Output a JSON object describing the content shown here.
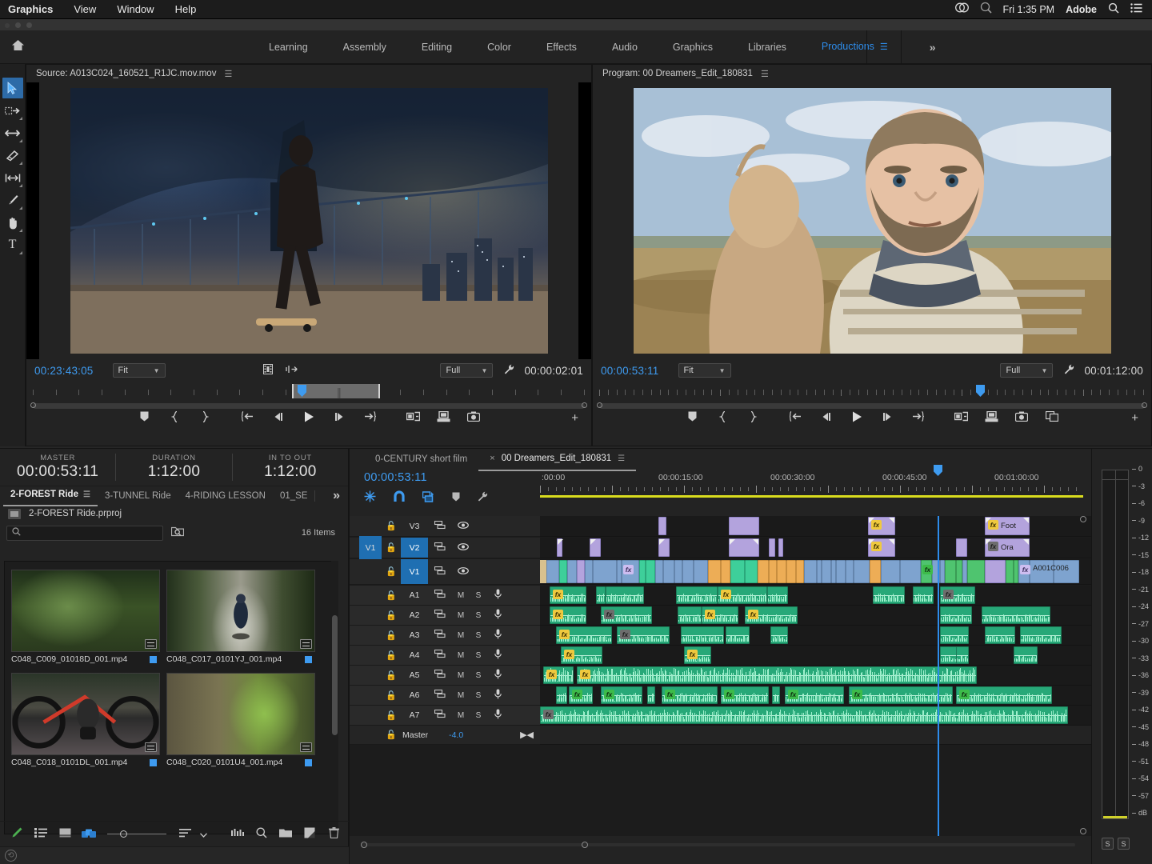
{
  "os_menu": {
    "items": [
      "Graphics",
      "View",
      "Window",
      "Help"
    ],
    "cc_icon": "creative-cloud-icon",
    "search_sys_icon": "spotlight-icon",
    "clock": "Fri 1:35 PM",
    "account": "Adobe",
    "search_icon": "search-icon",
    "list_icon": "control-center-icon"
  },
  "workspace": {
    "home_icon": "home-icon",
    "tabs": [
      {
        "label": "Learning",
        "active": false
      },
      {
        "label": "Assembly",
        "active": false
      },
      {
        "label": "Editing",
        "active": false
      },
      {
        "label": "Color",
        "active": false
      },
      {
        "label": "Effects",
        "active": false
      },
      {
        "label": "Audio",
        "active": false
      },
      {
        "label": "Graphics",
        "active": false
      },
      {
        "label": "Libraries",
        "active": false
      },
      {
        "label": "Productions",
        "active": true
      }
    ],
    "overflow": "»"
  },
  "tools": [
    {
      "name": "selection-tool",
      "glyph": "➤",
      "active": true
    },
    {
      "name": "track-select-forward-tool",
      "glyph": "⇢",
      "active": false
    },
    {
      "name": "ripple-edit-tool",
      "glyph": "↔",
      "active": false
    },
    {
      "name": "razor-tool",
      "glyph": "╱",
      "active": false
    },
    {
      "name": "slip-tool",
      "glyph": "↔",
      "active": false
    },
    {
      "name": "pen-tool",
      "glyph": "✒",
      "active": false
    },
    {
      "name": "hand-tool",
      "glyph": "✋",
      "active": false
    },
    {
      "name": "type-tool",
      "glyph": "T",
      "active": false
    }
  ],
  "source_monitor": {
    "title": "Source: A013C024_160521_R1JC.mov.mov",
    "menu_icon": "panel-menu-icon",
    "timecode_current": "00:23:43:05",
    "timecode_duration": "00:00:02:01",
    "zoom_level": "Fit",
    "resolution": "Full",
    "settings_icon": "wrench-icon",
    "drag_video_icon": "drag-video-only-icon",
    "drag_audio_icon": "drag-audio-only-icon",
    "transport": [
      {
        "name": "add-marker-button",
        "glyph": "⮟"
      },
      {
        "name": "mark-in-button",
        "glyph": "{"
      },
      {
        "name": "mark-out-button",
        "glyph": "}"
      },
      {
        "name": "go-to-in-button",
        "glyph": "⇤"
      },
      {
        "name": "step-back-button",
        "glyph": "◀"
      },
      {
        "name": "play-stop-button",
        "glyph": "▶"
      },
      {
        "name": "step-forward-button",
        "glyph": "▷"
      },
      {
        "name": "go-to-out-button",
        "glyph": "⇥"
      },
      {
        "name": "insert-button",
        "glyph": "▤"
      },
      {
        "name": "overwrite-button",
        "glyph": "▥"
      },
      {
        "name": "export-frame-button",
        "glyph": "▣"
      }
    ],
    "button_editor": "+"
  },
  "program_monitor": {
    "title": "Program: 00 Dreamers_Edit_180831",
    "menu_icon": "panel-menu-icon",
    "timecode_current": "00:00:53:11",
    "timecode_duration": "00:01:12:00",
    "zoom_level": "Fit",
    "resolution": "Full",
    "settings_icon": "wrench-icon",
    "transport": [
      {
        "name": "add-marker-button",
        "glyph": "⮟"
      },
      {
        "name": "mark-in-button",
        "glyph": "{"
      },
      {
        "name": "mark-out-button",
        "glyph": "}"
      },
      {
        "name": "go-to-in-button",
        "glyph": "⇤"
      },
      {
        "name": "step-back-button",
        "glyph": "◀"
      },
      {
        "name": "play-stop-button",
        "glyph": "▶"
      },
      {
        "name": "step-forward-button",
        "glyph": "▷"
      },
      {
        "name": "go-to-out-button",
        "glyph": "⇥"
      },
      {
        "name": "lift-button",
        "glyph": "▤"
      },
      {
        "name": "extract-button",
        "glyph": "▥"
      },
      {
        "name": "export-frame-button",
        "glyph": "▣"
      },
      {
        "name": "comparison-view-button",
        "glyph": "◫"
      }
    ],
    "button_editor": "+"
  },
  "info_bar": {
    "master": {
      "label": "MASTER",
      "value": "00:00:53:11"
    },
    "duration": {
      "label": "DURATION",
      "value": "1:12:00"
    },
    "in_to_out": {
      "label": "IN TO OUT",
      "value": "1:12:00"
    }
  },
  "project_panel": {
    "tabs": [
      {
        "label": "2-FOREST Ride",
        "active": true
      },
      {
        "label": "3-TUNNEL Ride",
        "active": false
      },
      {
        "label": "4-RIDING LESSON",
        "active": false
      },
      {
        "label": "01_SE",
        "active": false
      }
    ],
    "overflow": "»",
    "project_file": "2-FOREST Ride.prproj",
    "search_placeholder": "",
    "search_icon": "search-icon",
    "find_icon": "find-in-bin-icon",
    "item_count": "16 Items",
    "items": [
      {
        "name": "C048_C009_01018D_001.mp4",
        "thumb": "forest",
        "label_color": "#3e9bf0"
      },
      {
        "name": "C048_C017_0101YJ_001.mp4",
        "thumb": "road",
        "label_color": "#3e9bf0"
      },
      {
        "name": "C048_C018_0101DL_001.mp4",
        "thumb": "bike",
        "label_color": "#3e9bf0"
      },
      {
        "name": "C048_C020_0101U4_001.mp4",
        "thumb": "moss",
        "label_color": "#3e9bf0"
      }
    ],
    "toolbar": [
      {
        "name": "new-item-pen-icon",
        "glyph": "✎"
      },
      {
        "name": "list-view-icon",
        "glyph": "☰"
      },
      {
        "name": "icon-view-icon",
        "glyph": "■"
      },
      {
        "name": "freeform-view-icon",
        "glyph": "◰"
      },
      {
        "name": "zoom-slider",
        "glyph": ""
      },
      {
        "name": "sort-icon",
        "glyph": "≡"
      },
      {
        "name": "sort-chevron-icon",
        "glyph": "▾"
      },
      {
        "name": "automate-to-sequence-icon",
        "glyph": "▐▐"
      },
      {
        "name": "find-icon",
        "glyph": "⌕"
      },
      {
        "name": "new-bin-icon",
        "glyph": "▰"
      },
      {
        "name": "new-item-icon",
        "glyph": "◩"
      },
      {
        "name": "clear-icon",
        "glyph": "Ὕ1"
      }
    ]
  },
  "timeline": {
    "tabs": [
      {
        "label": "0-CENTURY short film",
        "active": false,
        "closable": false
      },
      {
        "label": "00 Dreamers_Edit_180831",
        "active": true,
        "closable": true
      }
    ],
    "close_glyph": "×",
    "menu_icon": "panel-menu-icon",
    "playhead_timecode": "00:00:53:11",
    "header_icons": [
      {
        "name": "nested-sequence-icon",
        "glyph": "✵",
        "on": true
      },
      {
        "name": "snap-icon",
        "glyph": "∩",
        "on": true
      },
      {
        "name": "linked-selection-icon",
        "glyph": "⎇",
        "on": true
      },
      {
        "name": "add-marker-icon",
        "glyph": "⮟",
        "on": false
      },
      {
        "name": "timeline-settings-icon",
        "glyph": "⚒",
        "on": false
      }
    ],
    "ruler_labels": [
      ":00:00",
      "00:00:15:00",
      "00:00:30:00",
      "00:00:45:00",
      "00:01:00:00"
    ],
    "video_tracks": [
      {
        "name": "V3",
        "source_target": "",
        "lock_icon": "lock-icon",
        "target_icon": "track-target-icon",
        "eye_icon": "eye-icon",
        "source_active": false,
        "target_active": false
      },
      {
        "name": "V2",
        "source_target": "V1",
        "lock_icon": "lock-icon",
        "target_icon": "track-target-icon",
        "eye_icon": "eye-icon",
        "source_active": true,
        "target_active": true
      },
      {
        "name": "V1",
        "source_target": "",
        "lock_icon": "lock-icon",
        "target_icon": "track-target-icon",
        "eye_icon": "eye-icon",
        "source_active": false,
        "target_active": true
      }
    ],
    "audio_tracks": [
      {
        "name": "A1",
        "mute": "M",
        "solo": "S",
        "lock_icon": "lock-icon",
        "target_icon": "track-target-icon",
        "mic_icon": "microphone-icon"
      },
      {
        "name": "A2",
        "mute": "M",
        "solo": "S",
        "lock_icon": "lock-icon",
        "target_icon": "track-target-icon",
        "mic_icon": "microphone-icon"
      },
      {
        "name": "A3",
        "mute": "M",
        "solo": "S",
        "lock_icon": "lock-icon",
        "target_icon": "track-target-icon",
        "mic_icon": "microphone-icon"
      },
      {
        "name": "A4",
        "mute": "M",
        "solo": "S",
        "lock_icon": "lock-icon",
        "target_icon": "track-target-icon",
        "mic_icon": "microphone-icon"
      },
      {
        "name": "A5",
        "mute": "M",
        "solo": "S",
        "lock_icon": "lock-icon",
        "target_icon": "track-target-icon",
        "mic_icon": "microphone-icon"
      },
      {
        "name": "A6",
        "mute": "M",
        "solo": "S",
        "lock_icon": "lock-icon",
        "target_icon": "track-target-icon",
        "mic_icon": "microphone-icon"
      },
      {
        "name": "A7",
        "mute": "M",
        "solo": "S",
        "lock_icon": "lock-icon",
        "target_icon": "track-target-icon",
        "mic_icon": "microphone-icon"
      }
    ],
    "master_track": {
      "name": "Master",
      "level": "-4.0",
      "lock_icon": "lock-icon",
      "pan_icon": "pan-icon"
    },
    "clip_labels": {
      "v3_foot": "Foot",
      "v2_ora": "Ora",
      "v1_a001": "A001C006"
    }
  },
  "audio_meters": {
    "scale": [
      "0",
      "-3",
      "-6",
      "-9",
      "-12",
      "-15",
      "-18",
      "-21",
      "-24",
      "-27",
      "-30",
      "-33",
      "-36",
      "-39",
      "-42",
      "-45",
      "-48",
      "-51",
      "-54",
      "-57",
      "dB"
    ],
    "solo_buttons": [
      "S",
      "S"
    ],
    "level_color": "#cfd12a"
  },
  "colors": {
    "accent": "#2d8ceb",
    "panel_bg": "#232323",
    "timeline_bg": "#1a1a1a",
    "video_clip": "#b3a3dd",
    "audio_clip": "#27a878",
    "yellow_render_bar": "#d9dc1e"
  }
}
